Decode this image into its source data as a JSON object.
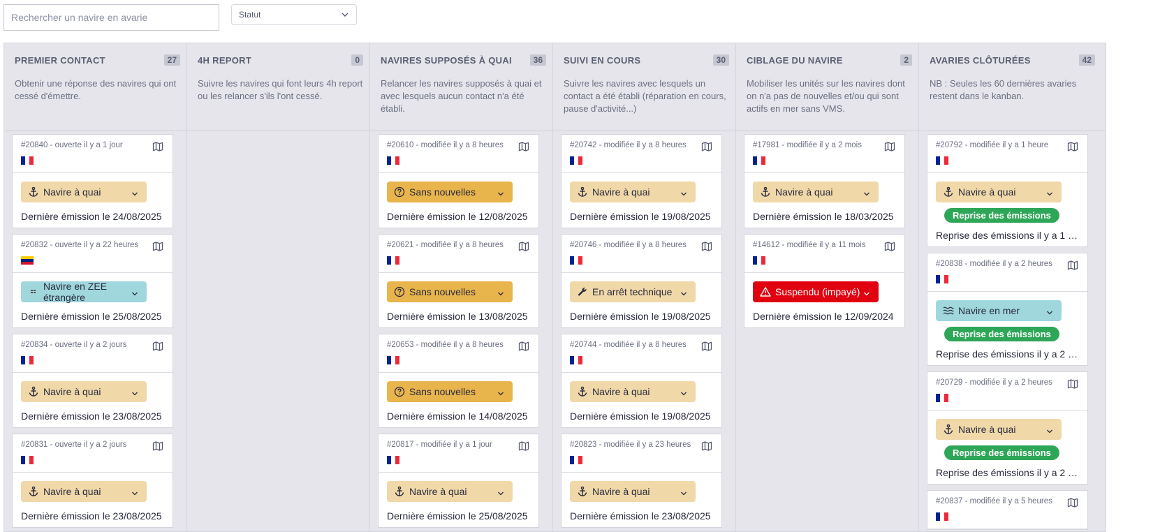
{
  "search": {
    "placeholder": "Rechercher un navire en avarie"
  },
  "filter": {
    "status_label": "Statut"
  },
  "columns": [
    {
      "title": "PREMIER CONTACT",
      "count": "27",
      "description": "Obtenir une réponse des navires qui ont cessé d'émettre."
    },
    {
      "title": "4H REPORT",
      "count": "0",
      "description": "Suivre les navires qui font leurs 4h report ou les relancer s'ils l'ont cessé."
    },
    {
      "title": "NAVIRES SUPPOSÉS À QUAI",
      "count": "36",
      "description": "Relancer les navires supposés à quai et avec lesquels aucun contact n'a été établi."
    },
    {
      "title": "SUIVI EN COURS",
      "count": "30",
      "description": "Suivre les navires avec lesquels un contact a été établi (réparation en cours, pause d'activité...)"
    },
    {
      "title": "CIBLAGE DU NAVIRE",
      "count": "2",
      "description": "Mobiliser les unités sur les navires dont on n'a pas de nouvelles et/ou qui sont actifs en mer sans VMS."
    },
    {
      "title": "AVARIES CLÔTURÉES",
      "count": "42",
      "description": "NB : Seules les 60 dernières avaries restent dans le kanban."
    }
  ],
  "cards": {
    "c0": [
      {
        "id": "#20840 - ouverte il y a 1 jour",
        "flag": "fr",
        "status": "Navire à quai",
        "status_kind": "quai",
        "last": "Dernière émission le 24/08/2025"
      },
      {
        "id": "#20832 - ouverte il y a 22 heures",
        "flag": "ve",
        "status": "Navire en ZEE étrangère",
        "status_kind": "zee",
        "last": "Dernière émission le 25/08/2025"
      },
      {
        "id": "#20834 - ouverte il y a 2 jours",
        "flag": "fr",
        "status": "Navire à quai",
        "status_kind": "quai",
        "last": "Dernière émission le 23/08/2025"
      },
      {
        "id": "#20831 - ouverte il y a 2 jours",
        "flag": "fr",
        "status": "Navire à quai",
        "status_kind": "quai",
        "last": "Dernière émission le 23/08/2025"
      }
    ],
    "c2": [
      {
        "id": "#20610 - modifiée il y a 8 heures",
        "flag": "fr",
        "status": "Sans nouvelles",
        "status_kind": "sans",
        "last": "Dernière émission le 12/08/2025"
      },
      {
        "id": "#20621 - modifiée il y a 8 heures",
        "flag": "fr",
        "status": "Sans nouvelles",
        "status_kind": "sans",
        "last": "Dernière émission le 13/08/2025"
      },
      {
        "id": "#20653 - modifiée il y a 8 heures",
        "flag": "fr",
        "status": "Sans nouvelles",
        "status_kind": "sans",
        "last": "Dernière émission le 14/08/2025"
      },
      {
        "id": "#20817 - modifiée il y a 1 jour",
        "flag": "fr",
        "status": "Navire à quai",
        "status_kind": "quai",
        "last": "Dernière émission le 25/08/2025"
      }
    ],
    "c3": [
      {
        "id": "#20742 - modifiée il y a 8 heures",
        "flag": "fr",
        "status": "Navire à quai",
        "status_kind": "quai",
        "last": "Dernière émission le 19/08/2025"
      },
      {
        "id": "#20746 - modifiée il y a 8 heures",
        "flag": "fr",
        "status": "En arrêt technique",
        "status_kind": "arret",
        "last": "Dernière émission le 19/08/2025"
      },
      {
        "id": "#20744 - modifiée il y a 8 heures",
        "flag": "fr",
        "status": "Navire à quai",
        "status_kind": "quai",
        "last": "Dernière émission le 19/08/2025"
      },
      {
        "id": "#20823 - modifiée il y a 23 heures",
        "flag": "fr",
        "status": "Navire à quai",
        "status_kind": "quai",
        "last": "Dernière émission le 23/08/2025"
      }
    ],
    "c4": [
      {
        "id": "#17981 - modifiée il y a 2 mois",
        "flag": "fr",
        "status": "Navire à quai",
        "status_kind": "quai",
        "last": "Dernière émission le 18/03/2025"
      },
      {
        "id": "#14612 - modifiée il y a 11 mois",
        "flag": "fr",
        "status": "Suspendu (impayé)",
        "status_kind": "susp",
        "last": "Dernière émission le 12/09/2024"
      }
    ],
    "c5": [
      {
        "id": "#20792 - modifiée il y a 1 heure",
        "flag": "fr",
        "status": "Navire à quai",
        "status_kind": "quai",
        "badge": "Reprise des émissions",
        "last": "Reprise des émissions il y a 1 he..."
      },
      {
        "id": "#20838 - modifiée il y a 2 heures",
        "flag": "fr",
        "status": "Navire en mer",
        "status_kind": "mer",
        "badge": "Reprise des émissions",
        "last": "Reprise des émissions il y a 2 h..."
      },
      {
        "id": "#20729 - modifiée il y a 2 heures",
        "flag": "fr",
        "status": "Navire à quai",
        "status_kind": "quai",
        "badge": "Reprise des émissions",
        "last": "Reprise des émissions il y a 2 h..."
      },
      {
        "id": "#20837 - modifiée il y a 5 heures",
        "flag": "fr"
      }
    ]
  },
  "colors": {
    "column_bg": "#e5e5eb",
    "quai": "#f0d8a8",
    "sans_nouvelles": "#e8b44c",
    "zee_mer": "#9fd7dc",
    "suspendu": "#e1000f",
    "reprise": "#2ea657"
  },
  "icons": {
    "quai": "anchor-icon",
    "sans": "question-circle-icon",
    "zee": "grid-icon",
    "arret": "wrench-icon",
    "susp": "warning-icon",
    "mer": "waves-icon"
  }
}
